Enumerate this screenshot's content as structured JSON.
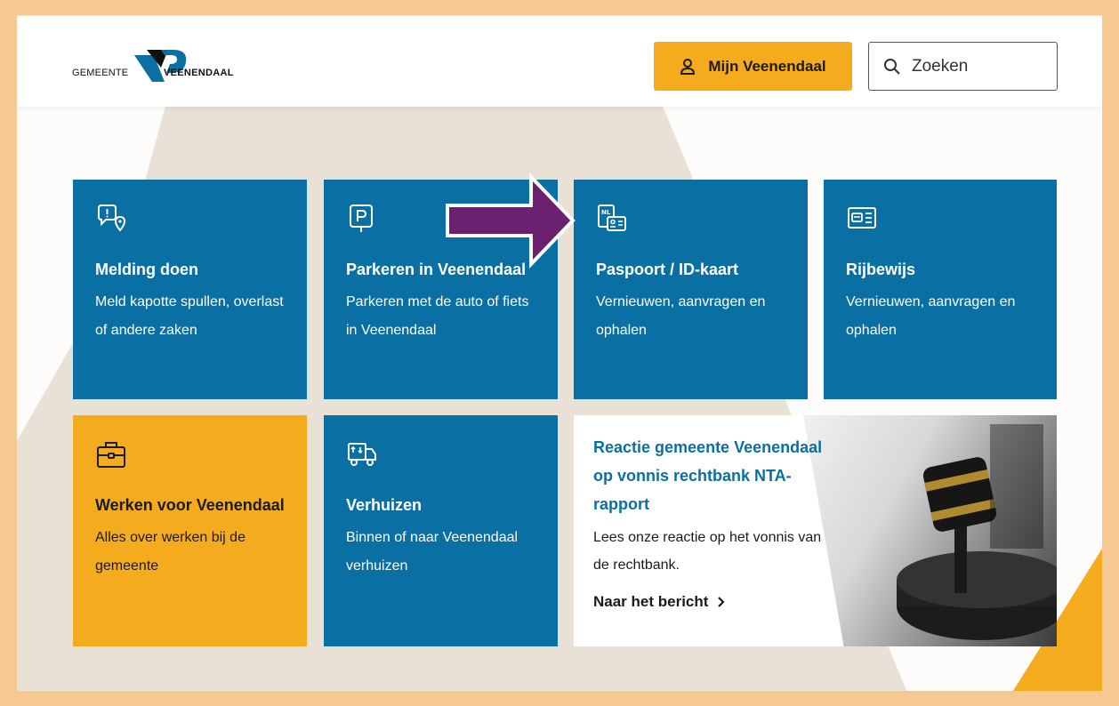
{
  "header": {
    "logo_left": "GEMEENTE",
    "logo_right": "VEENENDAAL",
    "account_button": "Mijn Veenendaal",
    "search_label": "Zoeken"
  },
  "tiles": [
    {
      "title": "Melding doen",
      "text": "Meld kapotte spullen, overlast of andere zaken",
      "icon": "report-location-icon"
    },
    {
      "title": "Parkeren in Veenendaal",
      "text": "Parkeren met de auto of fiets in Veenendaal",
      "icon": "parking-icon"
    },
    {
      "title": "Paspoort / ID-kaart",
      "text": "Vernieuwen, aanvragen en ophalen",
      "icon": "passport-id-icon"
    },
    {
      "title": "Rijbewijs",
      "text": "Vernieuwen, aanvragen en ophalen",
      "icon": "driving-license-icon"
    },
    {
      "title": "Werken voor Veenendaal",
      "text": "Alles over werken bij de gemeente",
      "icon": "briefcase-icon"
    },
    {
      "title": "Verhuizen",
      "text": "Binnen of naar Veenendaal verhuizen",
      "icon": "moving-truck-icon"
    }
  ],
  "news": {
    "title": "Reactie gemeente Veenendaal op vonnis rechtbank NTA-rapport",
    "text": "Lees onze reactie op het vonnis van de rechtbank.",
    "link": "Naar het bericht"
  },
  "colors": {
    "tile_blue": "#0a6fa3",
    "accent_yellow": "#f4ab1d",
    "arrow_purple": "#6b2170",
    "frame_border": "#f5c991"
  }
}
